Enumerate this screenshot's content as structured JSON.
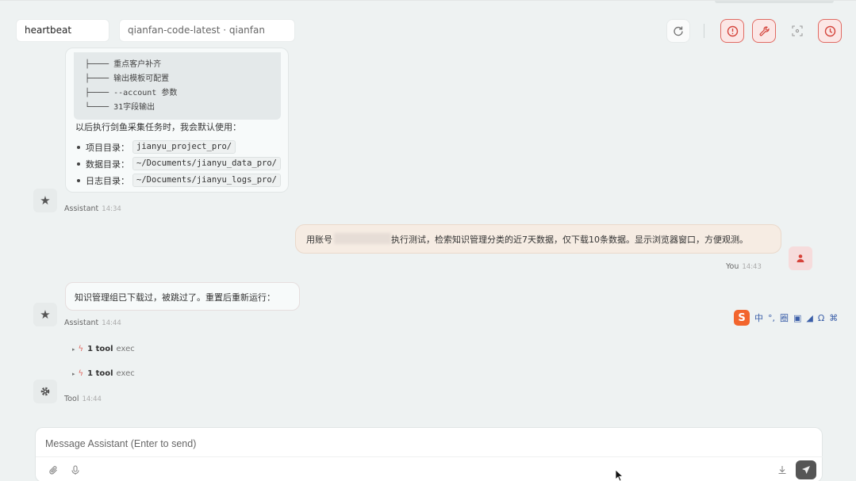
{
  "header": {
    "session": "heartbeat",
    "model": "qianfan-code-latest · qianfan",
    "icons": [
      "refresh-icon",
      "stop-icon",
      "wrench-icon",
      "focus-icon",
      "clock-icon"
    ]
  },
  "assistant_message_1": {
    "code_lines": [
      "├──── 重点客户补齐",
      "├──── 输出模板可配置",
      "├──── --account 参数",
      "└──── 31字段输出"
    ],
    "intro": "以后执行剑鱼采集任务时，我会默认使用：",
    "items": [
      {
        "label": "项目目录：",
        "code": "jianyu_project_pro/"
      },
      {
        "label": "数据目录：",
        "code": "~/Documents/jianyu_data_pro/"
      },
      {
        "label": "日志目录：",
        "code": "~/Documents/jianyu_logs_pro/"
      }
    ],
    "author": "Assistant",
    "time": "14:34"
  },
  "user_message": {
    "prefix": "用账号",
    "suffix": "执行测试，检索知识管理分类的近7天数据，仅下载10条数据。显示浏览器窗口，方便观测。",
    "author": "You",
    "time": "14:43"
  },
  "assistant_message_2": {
    "text": "知识管理组已下载过，被跳过了。重置后重新运行：",
    "author": "Assistant",
    "time": "14:44"
  },
  "tool_message": {
    "calls": [
      {
        "label": "1 tool",
        "kind": "exec"
      },
      {
        "label": "1 tool",
        "kind": "exec"
      }
    ],
    "author": "Tool",
    "time": "14:44"
  },
  "ime_toolbar": {
    "logo": "S",
    "items": [
      "中",
      "°,",
      "圈",
      "▣",
      "◢",
      "Ω",
      "⌘"
    ]
  },
  "composer": {
    "placeholder": "Message Assistant (Enter to send)"
  },
  "colors": {
    "accent_red": "#d4453c",
    "background": "#eef2f2",
    "user_bubble": "#f6ece3"
  }
}
